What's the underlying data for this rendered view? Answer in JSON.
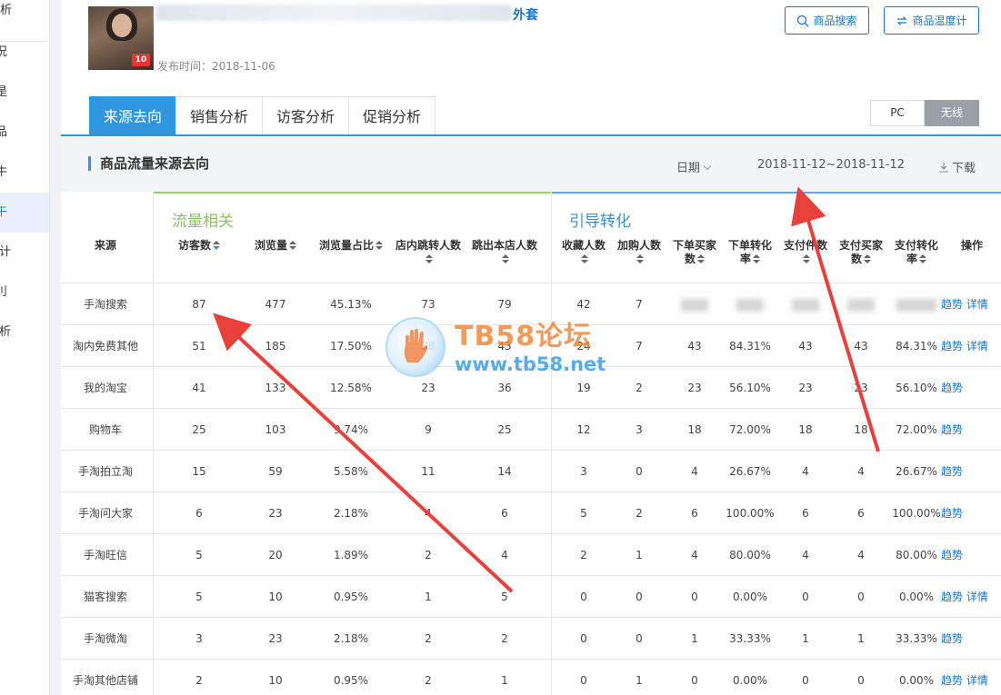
{
  "sidebar": {
    "items": [
      {
        "label": "析",
        "active": false
      },
      {
        "label": "况",
        "active": false
      },
      {
        "label": "是",
        "active": false
      },
      {
        "label": "品",
        "active": false
      },
      {
        "label": "牛",
        "active": false
      },
      {
        "label": "午",
        "active": true
      },
      {
        "label": "统计",
        "active": false
      },
      {
        "label": "刂",
        "active": false
      },
      {
        "label": "分析",
        "active": false
      }
    ]
  },
  "product": {
    "title_suffix": "外套",
    "publish_label": "发布时间：2018-11-06",
    "image_tag": "10"
  },
  "toolbar": {
    "search_label": "商品搜索",
    "temp_label": "商品温度计"
  },
  "tabs": [
    {
      "label": "来源去向",
      "active": true
    },
    {
      "label": "销售分析",
      "active": false
    },
    {
      "label": "访客分析",
      "active": false
    },
    {
      "label": "促销分析",
      "active": false
    }
  ],
  "device_toggle": {
    "pc": "PC",
    "wireless": "无线",
    "selected": "wireless"
  },
  "section": {
    "title": "商品流量来源去向",
    "date_label": "日期",
    "date_range": "2018-11-12~2018-11-12",
    "download_label": "下载"
  },
  "table": {
    "source_header": "来源",
    "groups": {
      "flow": "流量相关",
      "guide": "引导转化"
    },
    "columns": {
      "visitors": "访客数",
      "pv": "浏览量",
      "pv_ratio": "浏览量占比",
      "jump_in": "店内跳转人数",
      "jump_out": "跳出本店人数",
      "fav": "收藏人数",
      "cart": "加购人数",
      "order_buyers_1": "下单买家",
      "order_buyers_2": "数",
      "order_rate_1": "下单转化",
      "order_rate_2": "率",
      "pay_items": "支付件数",
      "pay_buyers_1": "支付买家",
      "pay_buyers_2": "数",
      "pay_rate_1": "支付转化",
      "pay_rate_2": "率",
      "action": "操作"
    },
    "rows": [
      {
        "source": "手淘搜索",
        "visitors": "87",
        "pv": "477",
        "pv_ratio": "45.13%",
        "jump_in": "73",
        "jump_out": "79",
        "fav": "42",
        "cart": "7",
        "order_buyers": "",
        "order_rate": "",
        "pay_items": "",
        "pay_buyers": "",
        "pay_rate": "",
        "trend": "趋势",
        "detail": "详情",
        "blurred": true
      },
      {
        "source": "淘内免费其他",
        "visitors": "51",
        "pv": "185",
        "pv_ratio": "17.50%",
        "jump_in": "38",
        "jump_out": "43",
        "fav": "24",
        "cart": "7",
        "order_buyers": "43",
        "order_rate": "84.31%",
        "pay_items": "43",
        "pay_buyers": "43",
        "pay_rate": "84.31%",
        "trend": "趋势",
        "detail": "详情"
      },
      {
        "source": "我的淘宝",
        "visitors": "41",
        "pv": "133",
        "pv_ratio": "12.58%",
        "jump_in": "23",
        "jump_out": "36",
        "fav": "19",
        "cart": "2",
        "order_buyers": "23",
        "order_rate": "56.10%",
        "pay_items": "23",
        "pay_buyers": "23",
        "pay_rate": "56.10%",
        "trend": "趋势",
        "detail": ""
      },
      {
        "source": "购物车",
        "visitors": "25",
        "pv": "103",
        "pv_ratio": "9.74%",
        "jump_in": "9",
        "jump_out": "25",
        "fav": "12",
        "cart": "3",
        "order_buyers": "18",
        "order_rate": "72.00%",
        "pay_items": "18",
        "pay_buyers": "18",
        "pay_rate": "72.00%",
        "trend": "趋势",
        "detail": ""
      },
      {
        "source": "手淘拍立淘",
        "visitors": "15",
        "pv": "59",
        "pv_ratio": "5.58%",
        "jump_in": "11",
        "jump_out": "14",
        "fav": "3",
        "cart": "0",
        "order_buyers": "4",
        "order_rate": "26.67%",
        "pay_items": "4",
        "pay_buyers": "4",
        "pay_rate": "26.67%",
        "trend": "趋势",
        "detail": ""
      },
      {
        "source": "手淘问大家",
        "visitors": "6",
        "pv": "23",
        "pv_ratio": "2.18%",
        "jump_in": "4",
        "jump_out": "6",
        "fav": "5",
        "cart": "2",
        "order_buyers": "6",
        "order_rate": "100.00%",
        "pay_items": "6",
        "pay_buyers": "6",
        "pay_rate": "100.00%",
        "trend": "趋势",
        "detail": ""
      },
      {
        "source": "手淘旺信",
        "visitors": "5",
        "pv": "20",
        "pv_ratio": "1.89%",
        "jump_in": "2",
        "jump_out": "4",
        "fav": "2",
        "cart": "1",
        "order_buyers": "4",
        "order_rate": "80.00%",
        "pay_items": "4",
        "pay_buyers": "4",
        "pay_rate": "80.00%",
        "trend": "趋势",
        "detail": ""
      },
      {
        "source": "猫客搜索",
        "visitors": "5",
        "pv": "10",
        "pv_ratio": "0.95%",
        "jump_in": "1",
        "jump_out": "5",
        "fav": "0",
        "cart": "0",
        "order_buyers": "0",
        "order_rate": "0.00%",
        "pay_items": "0",
        "pay_buyers": "0",
        "pay_rate": "0.00%",
        "trend": "趋势",
        "detail": "详情"
      },
      {
        "source": "手淘微淘",
        "visitors": "3",
        "pv": "23",
        "pv_ratio": "2.18%",
        "jump_in": "2",
        "jump_out": "2",
        "fav": "0",
        "cart": "0",
        "order_buyers": "1",
        "order_rate": "33.33%",
        "pay_items": "1",
        "pay_buyers": "1",
        "pay_rate": "33.33%",
        "trend": "趋势",
        "detail": ""
      },
      {
        "source": "手淘其他店铺",
        "visitors": "2",
        "pv": "10",
        "pv_ratio": "0.95%",
        "jump_in": "2",
        "jump_out": "1",
        "fav": "0",
        "cart": "1",
        "order_buyers": "0",
        "order_rate": "0.00%",
        "pay_items": "0",
        "pay_buyers": "0",
        "pay_rate": "0.00%",
        "trend": "趋势",
        "detail": "详情"
      }
    ]
  },
  "watermark": {
    "line1": "TB58论坛",
    "line2": "www.tb58.net"
  },
  "colors": {
    "accent": "#2f96df",
    "link": "#1a73c8",
    "flow_green": "#8cc063",
    "guide_blue": "#3b8fd9",
    "arrow_red": "#e8403a"
  }
}
